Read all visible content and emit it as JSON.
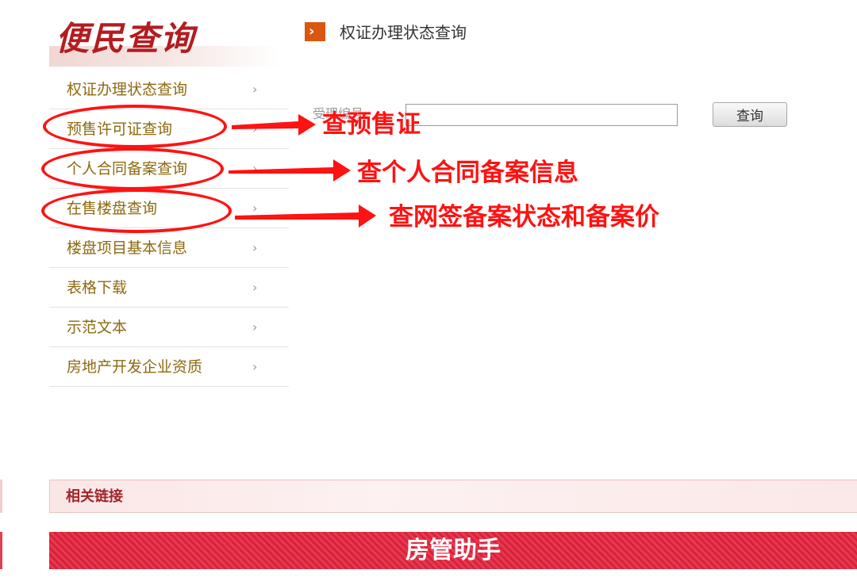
{
  "logo": {
    "text": "便民查询"
  },
  "page_title": "权证办理状态查询",
  "sidebar": {
    "items": [
      {
        "label": "权证办理状态查询",
        "chevron": "›"
      },
      {
        "label": "预售许可证查询",
        "chevron": "›"
      },
      {
        "label": "个人合同备案查询",
        "chevron": "›"
      },
      {
        "label": "在售楼盘查询",
        "chevron": "›"
      },
      {
        "label": "楼盘项目基本信息",
        "chevron": "›"
      },
      {
        "label": "表格下载",
        "chevron": "›"
      },
      {
        "label": "示范文本",
        "chevron": "›"
      },
      {
        "label": "房地产开发企业资质",
        "chevron": "›"
      }
    ]
  },
  "form": {
    "label": "受理编号",
    "input_value": "",
    "button_label": "查询"
  },
  "annotations": [
    {
      "text": "查预售证"
    },
    {
      "text": "查个人合同备案信息"
    },
    {
      "text": "查网签备案状态和备案价"
    }
  ],
  "links_bar": {
    "label": "相关链接"
  },
  "banner": {
    "label": "房管助手"
  },
  "colors": {
    "accent_red": "#ff1212",
    "sidebar_text": "#8d6a10",
    "banner": "#d9223a",
    "title_arrow": "#d9570e"
  }
}
